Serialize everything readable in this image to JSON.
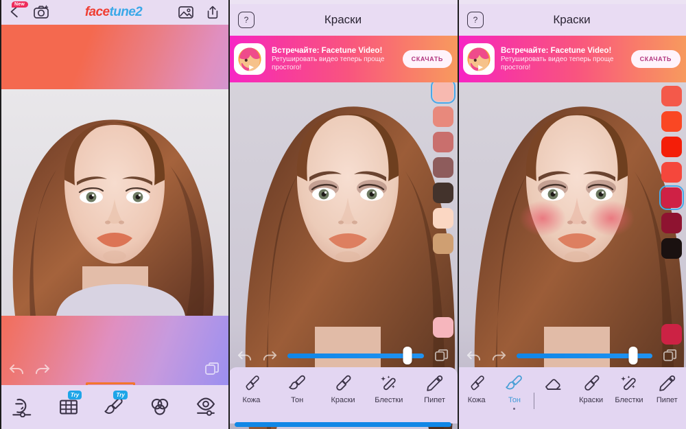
{
  "app": {
    "brand_first": "face",
    "brand_second": "tune2",
    "new_badge": "New"
  },
  "panel1": {
    "header": {
      "back_icon": "back-chevron-icon",
      "camera_icon": "camera-icon",
      "gallery_icon": "gallery-icon",
      "share_icon": "share-icon"
    },
    "controls": {
      "undo_icon": "undo-icon",
      "redo_icon": "redo-icon",
      "compare_icon": "compare-layers-icon"
    },
    "tools": [
      {
        "name": "retouch-tool",
        "icon": "face-slider-icon",
        "badge": "",
        "selected": false
      },
      {
        "name": "reshape-tool",
        "icon": "grid-reshape-icon",
        "badge": "Try",
        "selected": false
      },
      {
        "name": "paint-tool",
        "icon": "brush-icon",
        "badge": "Try",
        "selected": true
      },
      {
        "name": "filters-tool",
        "icon": "three-circles-icon",
        "badge": "",
        "selected": false
      },
      {
        "name": "eyes-tool",
        "icon": "eye-slider-icon",
        "badge": "",
        "selected": false
      }
    ]
  },
  "panel2": {
    "header": {
      "help_label": "?",
      "title": "Краски"
    },
    "banner": {
      "title": "Встречайте: Facetune Video!",
      "subtitle": "Ретушировать видео теперь проще простого!",
      "button": "СКАЧАТЬ",
      "app_icon": "facetune-video-app-icon"
    },
    "swatches": [
      {
        "color": "#f7b9b0",
        "selected": true
      },
      {
        "color": "#e8897c",
        "selected": false
      },
      {
        "color": "#c96f6d",
        "selected": false
      },
      {
        "color": "#8e5c5c",
        "selected": false
      },
      {
        "color": "#43332c",
        "selected": false
      },
      {
        "color": "#fbd7c3",
        "selected": false
      },
      {
        "color": "#cf9f72",
        "selected": false
      }
    ],
    "swatch_bottom": {
      "color": "#f6b6bd"
    },
    "controls": {
      "undo_icon": "undo-icon",
      "redo_icon": "redo-icon",
      "compare_icon": "compare-layers-icon",
      "slider_value": 88
    },
    "tabs": [
      {
        "label": "Кожа",
        "icon": "skin-brush-icon",
        "active": false,
        "eraser": false
      },
      {
        "label": "Тон",
        "icon": "tone-brush-icon",
        "active": false,
        "eraser": false
      },
      {
        "label": "Краски",
        "icon": "paint-marker-icon",
        "active": false,
        "eraser": false
      },
      {
        "label": "Блестки",
        "icon": "glitter-brush-icon",
        "active": false,
        "eraser": false
      },
      {
        "label": "Пипет",
        "icon": "eyedropper-icon",
        "active": false,
        "eraser": false
      }
    ]
  },
  "panel3": {
    "header": {
      "help_label": "?",
      "title": "Краски"
    },
    "banner": {
      "title": "Встречайте: Facetune Video!",
      "subtitle": "Ретушировать видео теперь проще простого!",
      "button": "СКАЧАТЬ",
      "app_icon": "facetune-video-app-icon"
    },
    "swatches": [
      {
        "color": "#f4594a",
        "selected": false
      },
      {
        "color": "#fa4723",
        "selected": false
      },
      {
        "color": "#f41e08",
        "selected": false
      },
      {
        "color": "#f5473c",
        "selected": false
      },
      {
        "color": "#cf2145",
        "selected": true
      },
      {
        "color": "#8e1330",
        "selected": false
      },
      {
        "color": "#1a1110",
        "selected": false
      }
    ],
    "swatch_bottom": {
      "color": "#cc2244"
    },
    "controls": {
      "undo_icon": "undo-icon",
      "redo_icon": "redo-icon",
      "compare_icon": "compare-layers-icon",
      "slider_value": 86
    },
    "tabs": [
      {
        "label": "Кожа",
        "icon": "skin-brush-icon",
        "active": false,
        "eraser": false
      },
      {
        "label": "Тон",
        "icon": "tone-brush-icon",
        "active": true,
        "eraser": true
      },
      {
        "label": "Краски",
        "icon": "paint-marker-icon",
        "active": false,
        "eraser": false
      },
      {
        "label": "Блестки",
        "icon": "glitter-brush-icon",
        "active": false,
        "eraser": false
      },
      {
        "label": "Пипет",
        "icon": "eyedropper-icon",
        "active": false,
        "eraser": false
      }
    ]
  },
  "colors": {
    "accent_blue": "#1187e6",
    "selection_orange": "#f3762c",
    "badge_pink": "#ee2b5b",
    "try_blue": "#1ea5e8"
  }
}
